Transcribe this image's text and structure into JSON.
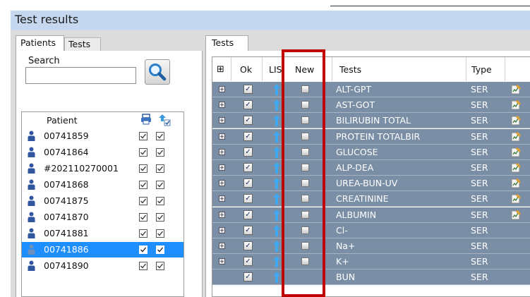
{
  "window": {
    "title": "Test results"
  },
  "left_panel": {
    "tabs": [
      {
        "label": "Patients",
        "active": true
      },
      {
        "label": "Tests",
        "active": false
      }
    ],
    "search": {
      "label": "Search",
      "value": "",
      "button_icon": "magnifier-icon"
    },
    "grid": {
      "header": {
        "patient": "Patient",
        "col1_icon": "printer-icon",
        "col2_icon": "upload-arrow-icon"
      },
      "rows": [
        {
          "id": "00741859",
          "col1": true,
          "col2": true,
          "selected": false
        },
        {
          "id": "00741864",
          "col1": true,
          "col2": true,
          "selected": false
        },
        {
          "id": "#202110270001",
          "col1": true,
          "col2": true,
          "selected": false
        },
        {
          "id": "00741868",
          "col1": true,
          "col2": true,
          "selected": false
        },
        {
          "id": "00741875",
          "col1": true,
          "col2": true,
          "selected": false
        },
        {
          "id": "00741870",
          "col1": true,
          "col2": true,
          "selected": false
        },
        {
          "id": "00741881",
          "col1": true,
          "col2": true,
          "selected": false
        },
        {
          "id": "00741886",
          "col1": true,
          "col2": true,
          "selected": true
        },
        {
          "id": "00741890",
          "col1": true,
          "col2": true,
          "selected": false
        }
      ]
    }
  },
  "right_panel": {
    "tab": "Tests",
    "columns": {
      "expand": "⊞",
      "ok": "Ok",
      "lis": "LIS",
      "new": "New",
      "tests": "Tests",
      "type": "Type"
    },
    "rows": [
      {
        "test": "ALT-GPT",
        "type": "SER",
        "edit": true,
        "expand": true,
        "new_box": true
      },
      {
        "test": "AST-GOT",
        "type": "SER",
        "edit": true,
        "expand": true,
        "new_box": true
      },
      {
        "test": "BILIRUBIN TOTAL",
        "type": "SER",
        "edit": true,
        "expand": true,
        "new_box": true
      },
      {
        "test": "PROTEIN TOTALBIR",
        "type": "SER",
        "edit": true,
        "expand": true,
        "new_box": true
      },
      {
        "test": "GLUCOSE",
        "type": "SER",
        "edit": true,
        "expand": true,
        "new_box": true
      },
      {
        "test": "ALP-DEA",
        "type": "SER",
        "edit": true,
        "expand": true,
        "new_box": true
      },
      {
        "test": "UREA-BUN-UV",
        "type": "SER",
        "edit": true,
        "expand": true,
        "new_box": true
      },
      {
        "test": "CREATININE",
        "type": "SER",
        "edit": true,
        "expand": true,
        "new_box": true
      },
      {
        "test": "ALBUMIN",
        "type": "SER",
        "edit": true,
        "expand": true,
        "new_box": true
      },
      {
        "test": "Cl-",
        "type": "SER",
        "edit": false,
        "expand": true,
        "new_box": true
      },
      {
        "test": "Na+",
        "type": "SER",
        "edit": false,
        "expand": true,
        "new_box": true
      },
      {
        "test": "K+",
        "type": "SER",
        "edit": false,
        "expand": true,
        "new_box": true
      },
      {
        "test": "BUN",
        "type": "SER",
        "edit": false,
        "expand": false,
        "new_box": false
      }
    ]
  },
  "colors": {
    "title_bar": "#c6d8ef",
    "row_bg": "#7a8ea5",
    "selection": "#1f8fff",
    "highlight": "#c00000"
  }
}
